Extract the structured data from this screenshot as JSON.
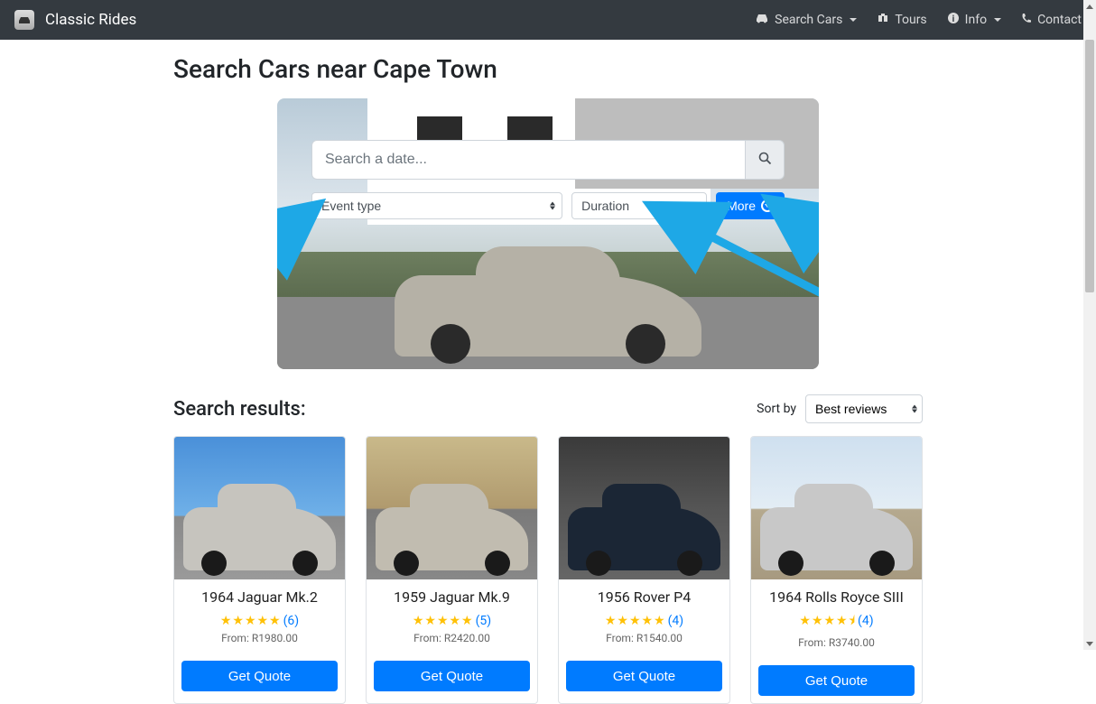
{
  "brand": "Classic Rides",
  "nav": {
    "search_cars": "Search Cars",
    "tours": "Tours",
    "info": "Info",
    "contact": "Contact"
  },
  "page_title": "Search Cars near Cape Town",
  "search": {
    "placeholder": "Search a date...",
    "event_type_label": "Event type",
    "duration_label": "Duration",
    "more_label": "More"
  },
  "results_heading": "Search results:",
  "sort": {
    "label": "Sort by",
    "value": "Best reviews"
  },
  "cards": [
    {
      "title": "1964 Jaguar Mk.2",
      "rating": 5,
      "reviews": "(6)",
      "from": "From: R1980.00",
      "quote": "Get Quote"
    },
    {
      "title": "1959 Jaguar Mk.9",
      "rating": 5,
      "reviews": "(5)",
      "from": "From: R2420.00",
      "quote": "Get Quote"
    },
    {
      "title": "1956 Rover P4",
      "rating": 5,
      "reviews": "(4)",
      "from": "From: R1540.00",
      "quote": "Get Quote"
    },
    {
      "title": "1964 Rolls Royce SIII",
      "rating": 4.5,
      "reviews": "(4)",
      "from": "From: R3740.00",
      "quote": "Get Quote"
    }
  ],
  "stars": {
    "full5": "★★★★★",
    "four_half": "★★★★⯨"
  },
  "colors": {
    "primary": "#007bff",
    "navbar": "#343a40",
    "arrow": "#1ea8e6",
    "star": "#ffc107"
  }
}
